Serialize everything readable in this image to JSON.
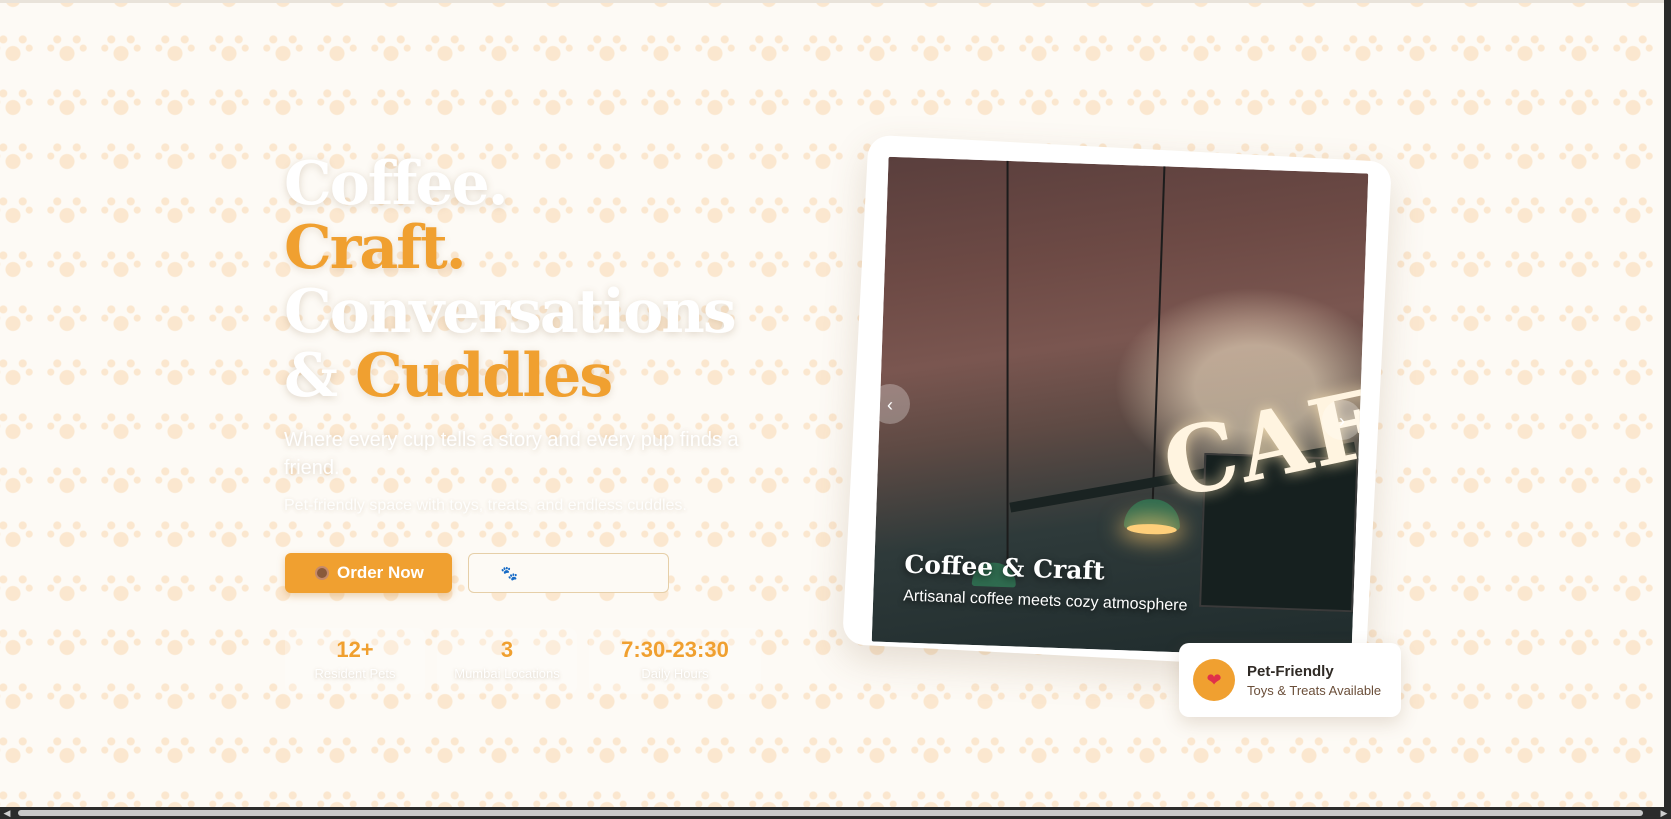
{
  "hero": {
    "headline": {
      "line1": "Coffee.",
      "line2": "Craft.",
      "line3": "Conversations",
      "line4_amp": "&",
      "line4_word": "Cuddles"
    },
    "tagline": "Where every cup tells a story and every pup finds a friend.",
    "subline": "Pet-friendly space with toys, treats, and endless cuddles.",
    "buttons": {
      "order_label": "Order Now",
      "secondary_label": ""
    },
    "stats": [
      {
        "value": "12+",
        "label": "Resident Pets"
      },
      {
        "value": "3",
        "label": "Mumbai Locations"
      },
      {
        "value": "7:30-23:30",
        "label": "Daily Hours"
      }
    ]
  },
  "carousel": {
    "slide": {
      "title": "Coffee & Craft",
      "subtitle": "Artisanal coffee meets cozy atmosphere",
      "sign_text": "CAF"
    },
    "prev_icon": "chevron-left-icon",
    "next_icon": "chevron-right-icon"
  },
  "badge": {
    "title": "Pet-Friendly",
    "subtitle": "Toys & Treats Available",
    "icon": "heart-icon"
  },
  "colors": {
    "accent": "#f0a030",
    "background": "#fdfaf5",
    "paw_pattern": "#fbe7cf"
  }
}
